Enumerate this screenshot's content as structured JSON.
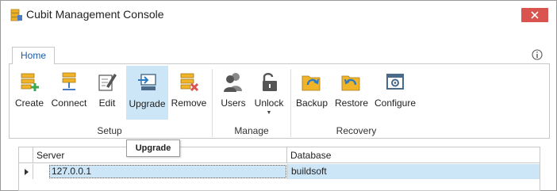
{
  "window": {
    "title": "Cubit Management Console",
    "close_icon": "close-icon",
    "close_color": "#d9534f"
  },
  "ribbon": {
    "tabs": [
      {
        "label": "Home",
        "active": true
      }
    ],
    "help_icon": "info-icon",
    "groups": [
      {
        "label": "Setup",
        "buttons": [
          {
            "label": "Create",
            "icon": "create-server-icon"
          },
          {
            "label": "Connect",
            "icon": "connect-server-icon"
          },
          {
            "label": "Edit",
            "icon": "edit-icon"
          },
          {
            "label": "Upgrade",
            "icon": "upgrade-icon",
            "selected": true
          },
          {
            "label": "Remove",
            "icon": "remove-server-icon"
          }
        ]
      },
      {
        "label": "Manage",
        "buttons": [
          {
            "label": "Users",
            "icon": "users-icon"
          },
          {
            "label": "Unlock",
            "icon": "unlock-icon",
            "dropdown": true
          }
        ]
      },
      {
        "label": "Recovery",
        "buttons": [
          {
            "label": "Backup",
            "icon": "backup-folder-icon"
          },
          {
            "label": "Restore",
            "icon": "restore-folder-icon"
          },
          {
            "label": "Configure",
            "icon": "configure-icon"
          }
        ]
      }
    ],
    "accent_color": "#cde6f7"
  },
  "tooltip": {
    "text": "Upgrade"
  },
  "grid": {
    "columns": [
      "Server",
      "Database"
    ],
    "rows": [
      {
        "server": "127.0.0.1",
        "database": "buildsoft",
        "selected": true
      }
    ]
  }
}
